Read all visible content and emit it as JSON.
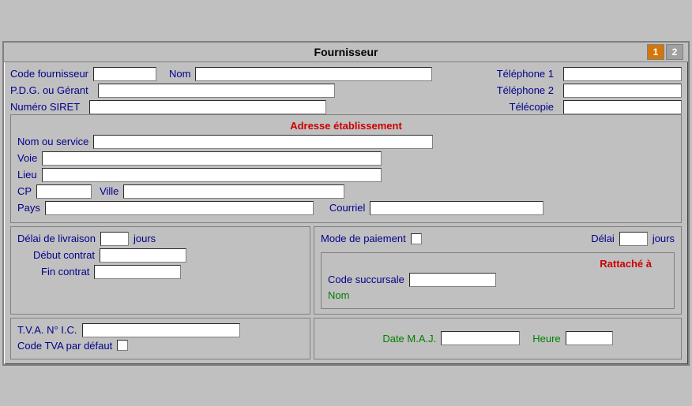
{
  "window": {
    "title": "Fournisseur",
    "btn1": "1",
    "btn2": "2"
  },
  "top": {
    "code_fournisseur_label": "Code fournisseur",
    "nom_label": "Nom",
    "telephone1_label": "Téléphone 1",
    "telephone2_label": "Téléphone 2",
    "telecopie_label": "Télécopie",
    "pdg_label": "P.D.G. ou Gérant",
    "numero_siret_label": "Numéro SIRET"
  },
  "adresse": {
    "section_title": "Adresse établissement",
    "nom_service_label": "Nom ou service",
    "voie_label": "Voie",
    "lieu_label": "Lieu",
    "cp_label": "CP",
    "ville_label": "Ville",
    "pays_label": "Pays",
    "courriel_label": "Courriel"
  },
  "contrat": {
    "delai_livraison_label": "Délai de livraison",
    "jours_label": "jours",
    "debut_contrat_label": "Début contrat",
    "fin_contrat_label": "Fin contrat",
    "mode_paiement_label": "Mode de paiement",
    "delai_label": "Délai",
    "jours2_label": "jours"
  },
  "rattache": {
    "section_title": "Rattaché à",
    "code_succursale_label": "Code succursale",
    "nom_label": "Nom"
  },
  "tva": {
    "tva_label": "T.V.A. N° I.C.",
    "code_tva_label": "Code TVA par défaut"
  },
  "maj": {
    "date_label": "Date M.A.J.",
    "heure_label": "Heure"
  }
}
